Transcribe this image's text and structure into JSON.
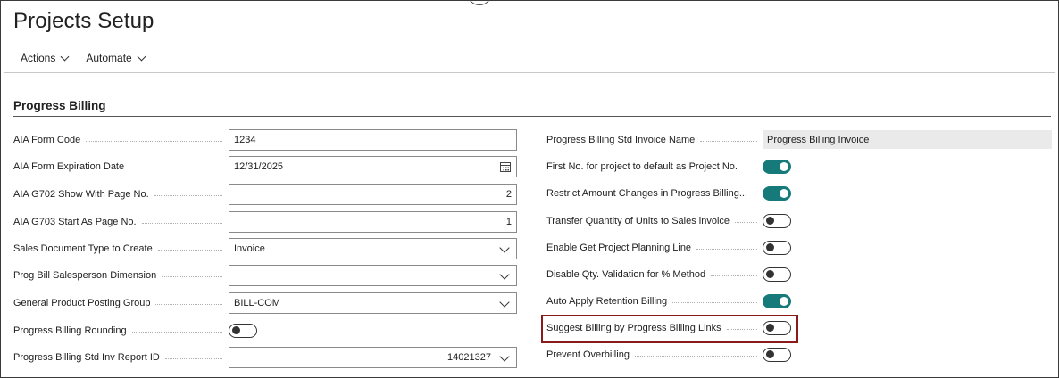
{
  "page": {
    "title": "Projects Setup"
  },
  "actions": [
    {
      "label": "Actions"
    },
    {
      "label": "Automate"
    }
  ],
  "section": {
    "title": "Progress Billing"
  },
  "left_fields": {
    "aia_form_code": {
      "label": "AIA Form Code",
      "value": "1234"
    },
    "aia_form_expiration_date": {
      "label": "AIA Form Expiration Date",
      "value": "12/31/2025"
    },
    "aia_g702_show_with_page_no": {
      "label": "AIA G702 Show With Page No.",
      "value": "2"
    },
    "aia_g703_start_as_page_no": {
      "label": "AIA G703 Start As Page No.",
      "value": "1"
    },
    "sales_document_type_to_create": {
      "label": "Sales Document Type to Create",
      "value": "Invoice"
    },
    "prog_bill_salesperson_dimension": {
      "label": "Prog Bill Salesperson Dimension",
      "value": ""
    },
    "general_product_posting_group": {
      "label": "General Product Posting Group",
      "value": "BILL-COM"
    },
    "progress_billing_rounding": {
      "label": "Progress Billing Rounding",
      "state": "off"
    },
    "progress_billing_std_inv_report_id": {
      "label": "Progress Billing Std Inv Report ID",
      "value": "14021327"
    }
  },
  "right_fields": {
    "std_invoice_name": {
      "label": "Progress Billing Std Invoice Name",
      "value": "Progress Billing Invoice"
    },
    "first_no_default": {
      "label": "First No. for project to default as Project No.",
      "state": "on"
    },
    "restrict_amount_changes": {
      "label": "Restrict Amount Changes in Progress Billing...",
      "state": "on"
    },
    "transfer_quantity": {
      "label": "Transfer Quantity of Units to Sales invoice",
      "state": "off"
    },
    "enable_get_planning_line": {
      "label": "Enable Get Project Planning Line",
      "state": "off"
    },
    "disable_qty_validation": {
      "label": "Disable Qty. Validation for % Method",
      "state": "off"
    },
    "auto_apply_retention": {
      "label": "Auto Apply Retention Billing",
      "state": "on"
    },
    "suggest_billing_links": {
      "label": "Suggest Billing by Progress Billing Links",
      "state": "off"
    },
    "prevent_overbilling": {
      "label": "Prevent Overbilling",
      "state": "off"
    }
  },
  "colors": {
    "toggle_on": "#167a7a",
    "highlight_border": "#8b1a1a"
  },
  "icons": {
    "calendar": "calendar-icon",
    "dropdown": "chevron-down-icon"
  }
}
